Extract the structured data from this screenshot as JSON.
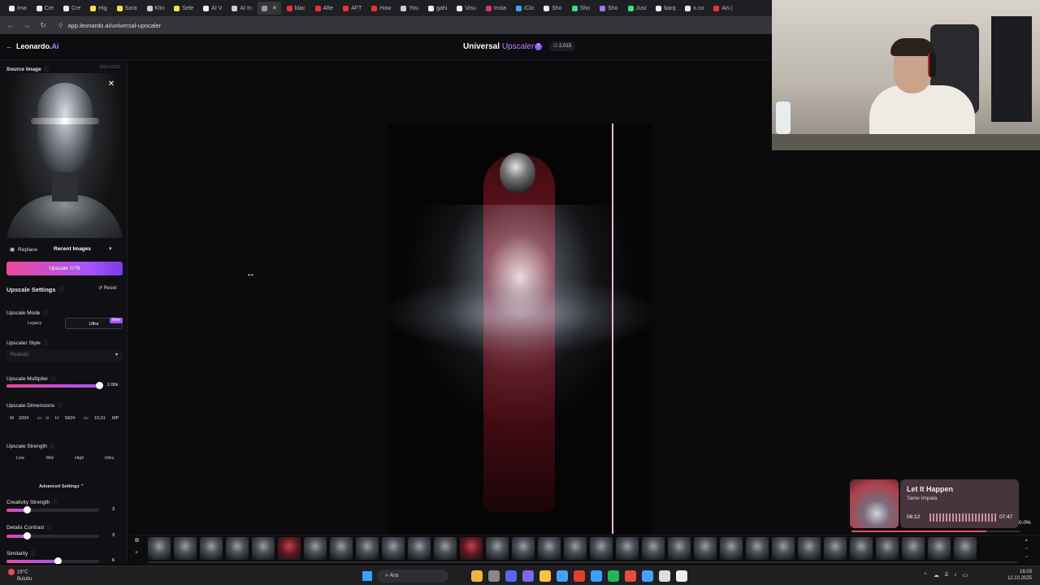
{
  "browser": {
    "tabs": [
      {
        "label": "Ima",
        "color": "#eee"
      },
      {
        "label": "Cre",
        "color": "#eee"
      },
      {
        "label": "Cre",
        "color": "#eee"
      },
      {
        "label": "Hig",
        "color": "#f2e24a"
      },
      {
        "label": "Sora",
        "color": "#f2e24a"
      },
      {
        "label": "Klin",
        "color": "#ccc"
      },
      {
        "label": "Sele",
        "color": "#f2e24a"
      },
      {
        "label": "AI V",
        "color": "#eee"
      },
      {
        "label": "AI In",
        "color": "#ccc"
      },
      {
        "label": "",
        "color": "#999",
        "active": true
      },
      {
        "label": "blac",
        "color": "#e33"
      },
      {
        "label": "Afte",
        "color": "#e33"
      },
      {
        "label": "AFT",
        "color": "#e33"
      },
      {
        "label": "How",
        "color": "#e33"
      },
      {
        "label": "You",
        "color": "#ccc"
      },
      {
        "label": "gahi",
        "color": "#eee"
      },
      {
        "label": "Visu",
        "color": "#eee"
      },
      {
        "label": "Insta",
        "color": "#e1306c"
      },
      {
        "label": "iClo",
        "color": "#4a9eff"
      },
      {
        "label": "Sho",
        "color": "#eee"
      },
      {
        "label": "Sho",
        "color": "#3ddc84"
      },
      {
        "label": "Sho",
        "color": "#a970ff"
      },
      {
        "label": "Just",
        "color": "#3ddc84"
      },
      {
        "label": "barq",
        "color": "#eee"
      },
      {
        "label": "x.co",
        "color": "#eee"
      },
      {
        "label": "Ais |",
        "color": "#e33"
      }
    ],
    "url": "app.leonardo.ai/universal-upscaler"
  },
  "header": {
    "logo_main": "Leonardo.",
    "logo_ai": "Ai",
    "title_main": "Universal",
    "title_accent": "Upscaler",
    "help": "?",
    "tokens": "⚇ 2,015"
  },
  "panel": {
    "source_label": "Source Image",
    "source_dims": "1632×2912",
    "replace_label": "Replace",
    "recent_label": "Recent Images",
    "upscale_button": "Upscale  ⚇76",
    "settings_label": "Upscale Settings",
    "reset_label": "↺ Reset",
    "mode_label": "Upscale Mode",
    "mode_options": [
      "Legacy",
      "Ultra"
    ],
    "mode_selected": "Ultra",
    "new_badge": "New",
    "style_label": "Upscaler Style",
    "style_value": "Realistic",
    "multiplier_label": "Upscale Multiplier",
    "multiplier_value": "2.00x",
    "multiplier_fraction": 1.0,
    "dimensions_label": "Upscale Dimensions",
    "dim_w_label": "W",
    "dim_w": "3264",
    "dim_px": "px",
    "dim_h_label": "H",
    "dim_h": "5824",
    "dim_mp": "19,01",
    "dim_mp_unit": "MP",
    "strength_label": "Upscale Strength",
    "strength_options": [
      "Low",
      "Mid",
      "High",
      "Ultra"
    ],
    "advanced_label": "Advanced Settings",
    "creativity_label": "Creativity Strength",
    "creativity_value": "3",
    "creativity_fraction": 0.22,
    "contrast_label": "Details Contrast",
    "contrast_value": "3",
    "contrast_fraction": 0.22,
    "similarity_label": "Similarity",
    "similarity_value": "6",
    "similarity_fraction": 0.55
  },
  "music": {
    "song": "Let It Happen",
    "artist": "Tame Impala",
    "elapsed": "06:12",
    "total": "07:47",
    "progress": 0.8,
    "overlay_pct": "0.0%"
  },
  "taskbar": {
    "temp": "18°C",
    "weather": "Bulutlu",
    "search_placeholder": "Ara",
    "time": "16:03",
    "date": "12.10.2025",
    "apps": [
      "#f0b443",
      "#888",
      "#5865f2",
      "#7b68ee",
      "#f5c542",
      "#4a9eff",
      "#e04030",
      "#3aa0ff",
      "#1db954",
      "#e84c3d",
      "#4a9eff",
      "#ddd",
      "#eee"
    ]
  }
}
